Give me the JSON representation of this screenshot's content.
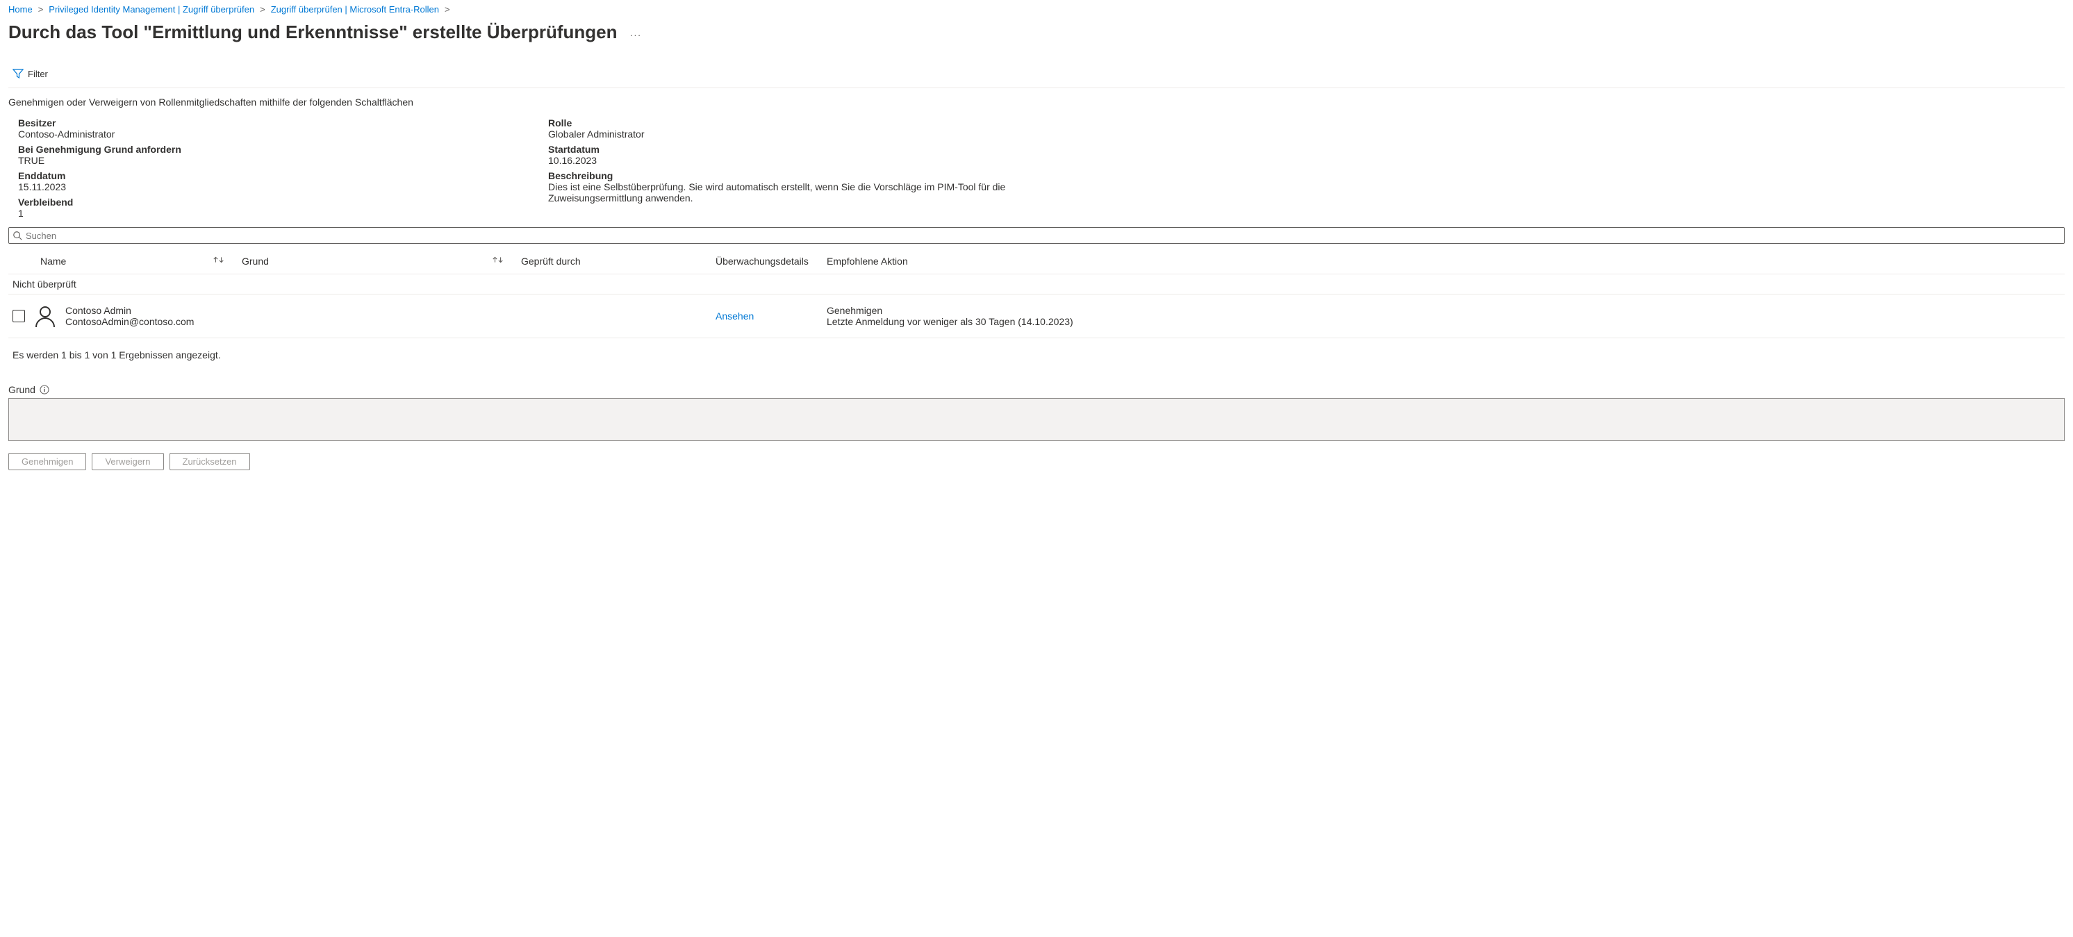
{
  "breadcrumb": {
    "items": [
      {
        "label": "Home"
      },
      {
        "label": "Privileged Identity Management | Zugriff überprüfen"
      },
      {
        "label": "Zugriff überprüfen | Microsoft Entra-Rollen"
      }
    ]
  },
  "page_title": "Durch das Tool \"Ermittlung und Erkenntnisse\" erstellte Überprüfungen",
  "title_more": "···",
  "toolbar": {
    "filter_label": "Filter"
  },
  "instruction": "Genehmigen oder Verweigern von Rollenmitgliedschaften mithilfe der folgenden Schaltflächen",
  "details": {
    "left": [
      {
        "label": "Besitzer",
        "value": "Contoso-Administrator"
      },
      {
        "label": "Bei Genehmigung Grund anfordern",
        "value": "TRUE"
      },
      {
        "label": "Enddatum",
        "value": "15.11.2023"
      },
      {
        "label": "Verbleibend",
        "value": "1"
      }
    ],
    "right": [
      {
        "label": "Rolle",
        "value": "Globaler Administrator"
      },
      {
        "label": "Startdatum",
        "value": "10.16.2023"
      },
      {
        "label": "Beschreibung",
        "value": "Dies ist eine Selbstüberprüfung. Sie wird automatisch erstellt, wenn Sie die Vorschläge im PIM-Tool für die Zuweisungsermittlung anwenden."
      }
    ]
  },
  "search": {
    "placeholder": "Suchen"
  },
  "columns": {
    "name": "Name",
    "reason": "Grund",
    "reviewed_by": "Geprüft durch",
    "audit": "Überwachungsdetails",
    "recommended": "Empfohlene Aktion"
  },
  "group_header": "Nicht überprüft",
  "rows": [
    {
      "name": "Contoso Admin",
      "email": "ContosoAdmin@contoso.com",
      "reason": "",
      "reviewed_by": "",
      "audit_link": "Ansehen",
      "recommended_action": "Genehmigen",
      "recommended_sub": "Letzte Anmeldung vor weniger als 30 Tagen (14.10.2023)"
    }
  ],
  "pager_text": "Es werden 1 bis 1 von 1 Ergebnissen angezeigt.",
  "reason_section": {
    "label": "Grund"
  },
  "buttons": {
    "approve": "Genehmigen",
    "deny": "Verweigern",
    "reset": "Zurücksetzen"
  }
}
